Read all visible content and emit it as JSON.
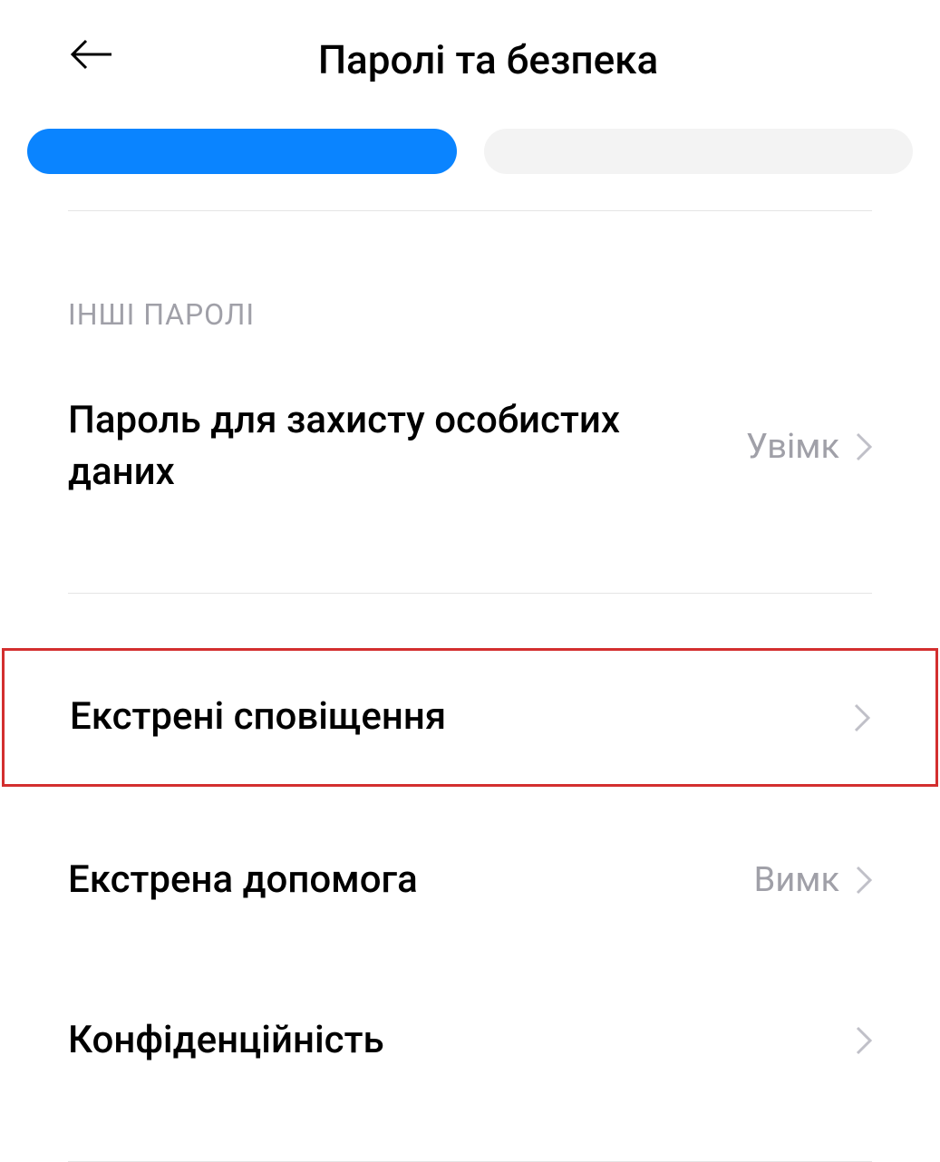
{
  "header": {
    "title": "Паролі та безпека"
  },
  "section": {
    "other_passwords_label": "ІНШІ ПАРОЛІ"
  },
  "settings": {
    "privacy_password": {
      "label": "Пароль для захисту особистих даних",
      "value": "Увімк"
    },
    "emergency_alerts": {
      "label": "Екстрені сповіщення"
    },
    "emergency_sos": {
      "label": "Екстрена допомога",
      "value": "Вимк"
    },
    "privacy": {
      "label": "Конфіденційність"
    }
  }
}
